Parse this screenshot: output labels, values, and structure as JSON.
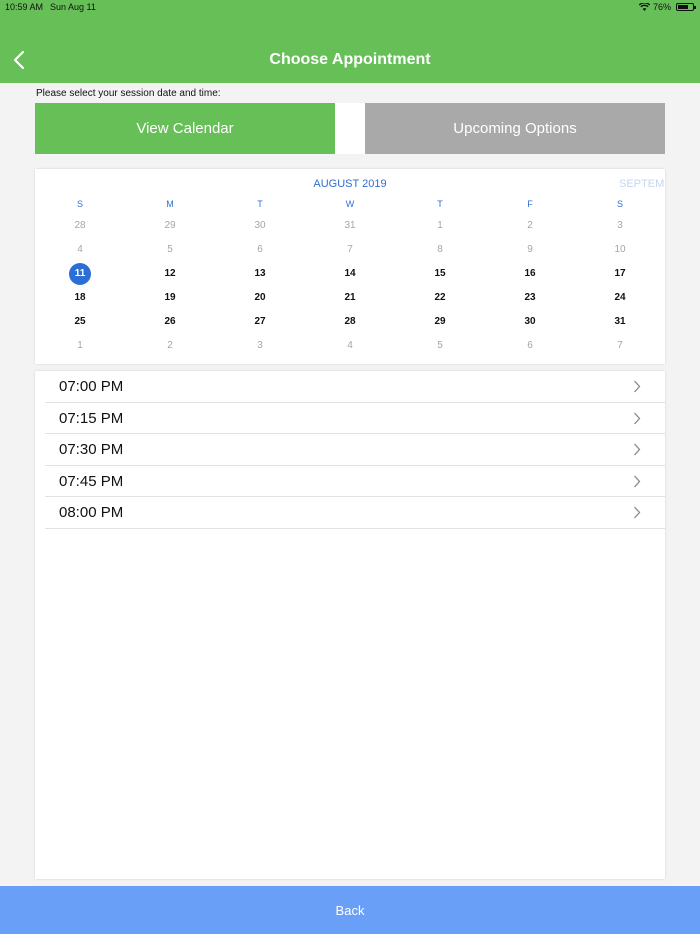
{
  "status_bar": {
    "time": "10:59 AM",
    "date": "Sun Aug 11",
    "battery": "76%"
  },
  "header": {
    "title": "Choose Appointment"
  },
  "instruction": "Please select your session date and time:",
  "tabs": {
    "calendar": "View Calendar",
    "upcoming": "Upcoming Options"
  },
  "calendar": {
    "month": "AUGUST 2019",
    "next_month": "SEPTEMB",
    "weekdays": [
      "S",
      "M",
      "T",
      "W",
      "T",
      "F",
      "S"
    ],
    "weeks": [
      [
        "28",
        "29",
        "30",
        "31",
        "1",
        "2",
        "3"
      ],
      [
        "4",
        "5",
        "6",
        "7",
        "8",
        "9",
        "10"
      ],
      [
        "11",
        "12",
        "13",
        "14",
        "15",
        "16",
        "17"
      ],
      [
        "18",
        "19",
        "20",
        "21",
        "22",
        "23",
        "24"
      ],
      [
        "25",
        "26",
        "27",
        "28",
        "29",
        "30",
        "31"
      ],
      [
        "1",
        "2",
        "3",
        "4",
        "5",
        "6",
        "7"
      ]
    ],
    "selected": "11"
  },
  "times": [
    "07:00 PM",
    "07:15 PM",
    "07:30 PM",
    "07:45 PM",
    "08:00 PM"
  ],
  "footer": {
    "back_label": "Back"
  },
  "colors": {
    "header_green": "#66bf57",
    "accent_blue": "#2b6fd6",
    "footer_blue": "#6a9ff8",
    "inactive_gray": "#a9a9a9"
  }
}
